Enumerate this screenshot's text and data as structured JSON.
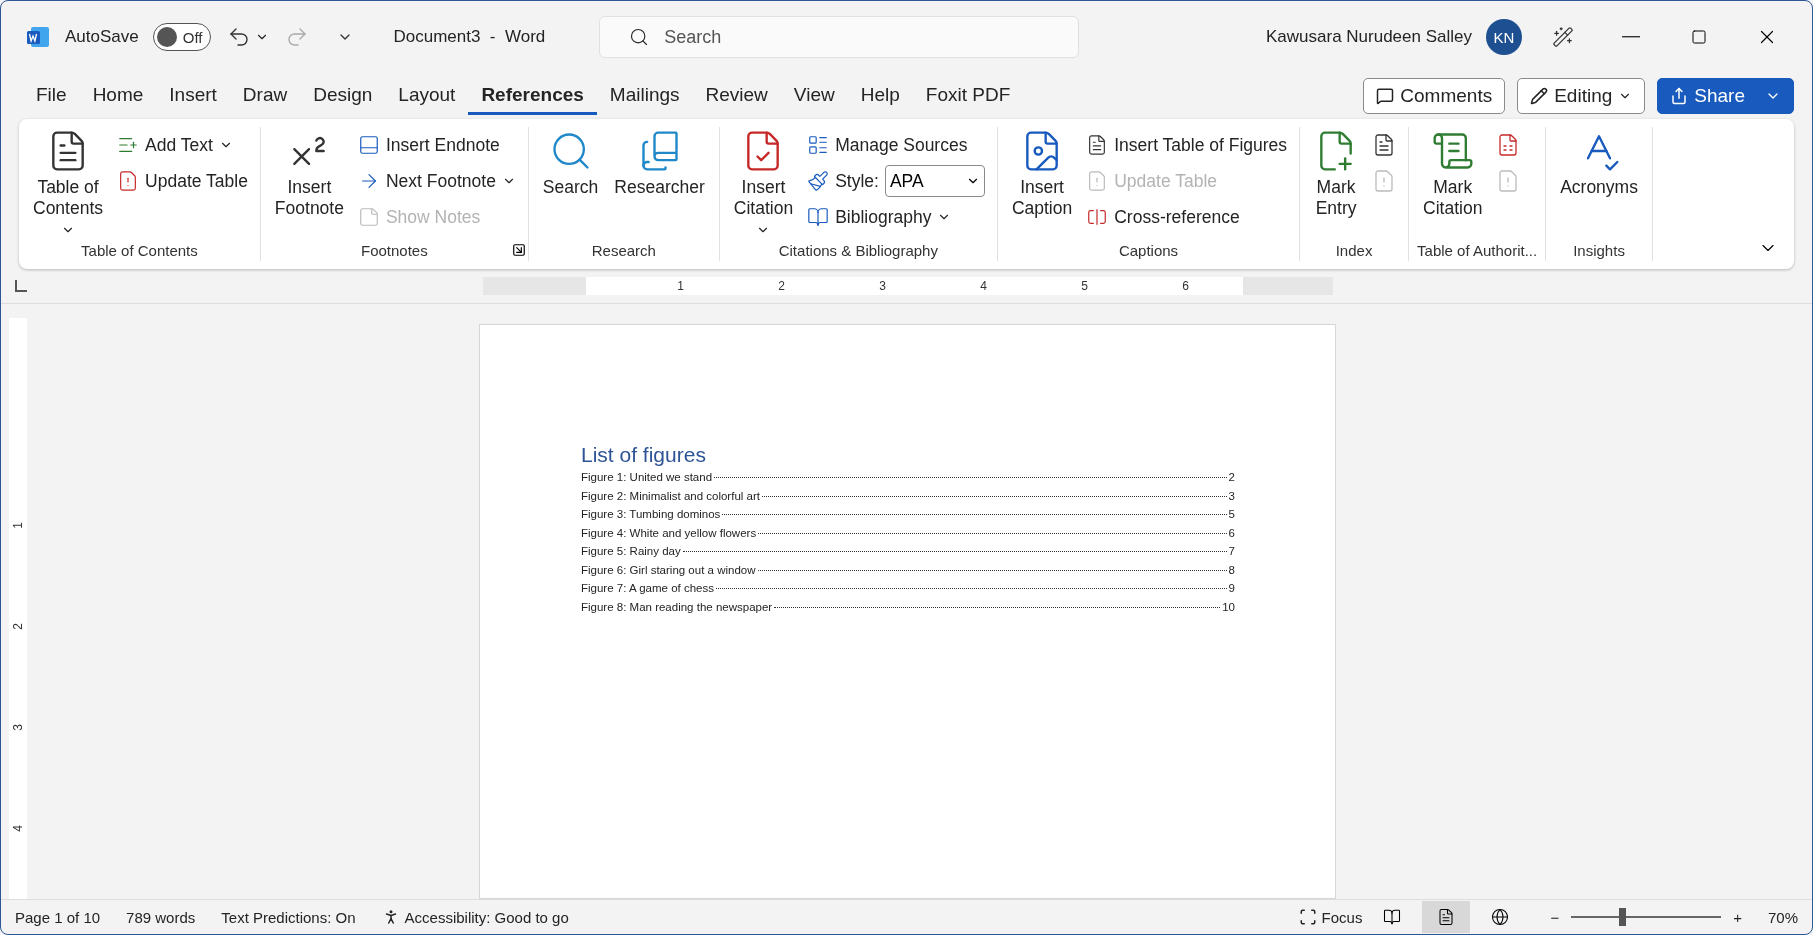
{
  "titlebar": {
    "autosave_label": "AutoSave",
    "autosave": {
      "on": false,
      "label": "Off"
    },
    "document_title": "Document3  -  Word",
    "search": {
      "placeholder": "Search"
    },
    "user_name": "Kawusara Nurudeen Salley",
    "avatar_initials": "KN"
  },
  "menu_tabs": [
    {
      "label": "File",
      "selected": false
    },
    {
      "label": "Home",
      "selected": false
    },
    {
      "label": "Insert",
      "selected": false
    },
    {
      "label": "Draw",
      "selected": false
    },
    {
      "label": "Design",
      "selected": false
    },
    {
      "label": "Layout",
      "selected": false
    },
    {
      "label": "References",
      "selected": true
    },
    {
      "label": "Mailings",
      "selected": false
    },
    {
      "label": "Review",
      "selected": false
    },
    {
      "label": "View",
      "selected": false
    },
    {
      "label": "Help",
      "selected": false
    },
    {
      "label": "Foxit PDF",
      "selected": false
    }
  ],
  "actions": {
    "comments": "Comments",
    "editing": "Editing",
    "share": "Share"
  },
  "ribbon_groups": [
    {
      "title": "Table of Contents",
      "items": [
        {
          "kind": "large",
          "label": "Table of\nContents",
          "caret": true
        },
        {
          "kind": "stack",
          "items": [
            {
              "kind": "small",
              "label": "Add Text",
              "caret": true
            },
            {
              "kind": "small",
              "label": "Update Table"
            }
          ]
        }
      ]
    },
    {
      "title": "Footnotes",
      "launcher": true,
      "items": [
        {
          "kind": "large",
          "label": "Insert\nFootnote"
        },
        {
          "kind": "stack",
          "items": [
            {
              "kind": "small",
              "label": "Insert Endnote"
            },
            {
              "kind": "small",
              "label": "Next Footnote",
              "caret": true
            },
            {
              "kind": "small",
              "label": "Show Notes",
              "disabled": true
            }
          ]
        }
      ]
    },
    {
      "title": "Research",
      "items": [
        {
          "kind": "large",
          "label": "Search"
        },
        {
          "kind": "large",
          "label": "Researcher"
        }
      ]
    },
    {
      "title": "Citations & Bibliography",
      "items": [
        {
          "kind": "large",
          "label": "Insert\nCitation",
          "caret": true
        },
        {
          "kind": "stack",
          "items": [
            {
              "kind": "small",
              "label": "Manage Sources"
            },
            {
              "kind": "select",
              "label": "Style:",
              "value": "APA"
            },
            {
              "kind": "small",
              "label": "Bibliography",
              "caret": true
            }
          ]
        }
      ]
    },
    {
      "title": "Captions",
      "items": [
        {
          "kind": "large",
          "label": "Insert\nCaption"
        },
        {
          "kind": "stack",
          "items": [
            {
              "kind": "small",
              "label": "Insert Table of Figures"
            },
            {
              "kind": "small",
              "label": "Update Table",
              "disabled": true
            },
            {
              "kind": "small",
              "label": "Cross-reference"
            }
          ]
        }
      ]
    },
    {
      "title": "Index",
      "items": [
        {
          "kind": "large",
          "label": "Mark\nEntry"
        },
        {
          "kind": "stack",
          "items": [
            {
              "kind": "icon"
            },
            {
              "kind": "icon",
              "disabled": true
            }
          ]
        }
      ]
    },
    {
      "title": "Table of Authorit...",
      "items": [
        {
          "kind": "large",
          "label": "Mark\nCitation"
        },
        {
          "kind": "stack",
          "items": [
            {
              "kind": "icon"
            },
            {
              "kind": "icon",
              "disabled": true
            }
          ]
        }
      ]
    },
    {
      "title": "Insights",
      "items": [
        {
          "kind": "large",
          "label": "Acronyms"
        }
      ]
    }
  ],
  "ruler": {
    "marks": [
      "1",
      "2",
      "3",
      "4",
      "5",
      "6"
    ],
    "vertical_marks": [
      "1",
      "2",
      "3",
      "4"
    ]
  },
  "document": {
    "heading": "List of figures",
    "entries": [
      {
        "label": "Figure 1: United we stand",
        "page": "2"
      },
      {
        "label": "Figure 2: Minimalist and colorful art",
        "page": "3"
      },
      {
        "label": "Figure 3: Tumbing dominos",
        "page": "5"
      },
      {
        "label": "Figure 4: White and yellow flowers",
        "page": "6"
      },
      {
        "label": "Figure 5: Rainy day",
        "page": "7"
      },
      {
        "label": "Figure 6: Girl staring out a window",
        "page": "8"
      },
      {
        "label": "Figure 7: A game of chess",
        "page": "9"
      },
      {
        "label": "Figure 8: Man reading the newspaper",
        "page": "10"
      }
    ]
  },
  "status_bar": {
    "page": "Page 1 of 10",
    "words": "789 words",
    "predictions": "Text Predictions: On",
    "accessibility": "Accessibility: Good to go",
    "focus": "Focus",
    "views": [
      {
        "selected": false
      },
      {
        "selected": true
      },
      {
        "selected": false
      }
    ],
    "zoom_out": "−",
    "zoom_in": "+",
    "zoom": {
      "level": 0.34
    },
    "zoom_label": "70%"
  }
}
